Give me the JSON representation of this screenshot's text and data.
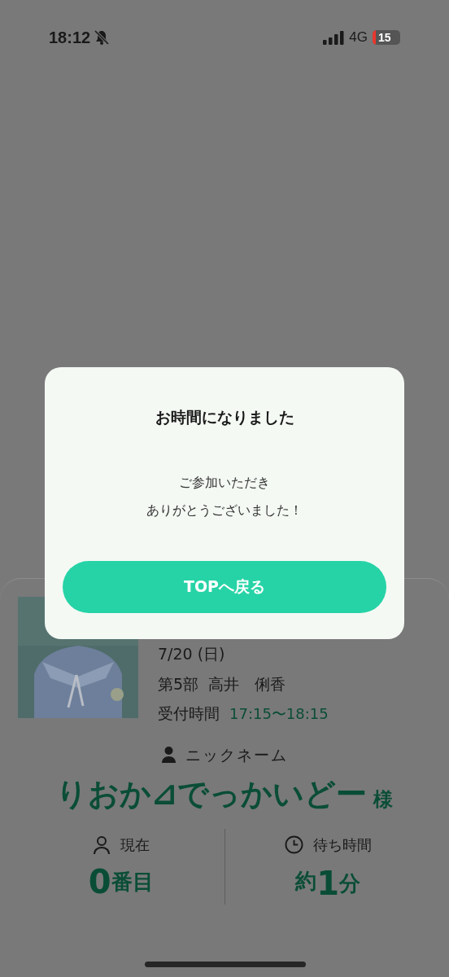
{
  "status_bar": {
    "time": "18:12",
    "silent": true,
    "network": "4G",
    "battery": "15"
  },
  "event_card": {
    "date": "7/20 (日)",
    "session": "第5部  高井　俐香",
    "reception_label": "受付時間",
    "reception_time": "17:15〜18:15"
  },
  "nickname": {
    "label": "ニックネーム",
    "name": "りおか⊿でっかいどー",
    "suffix": "様"
  },
  "stats": [
    {
      "kind": "person",
      "label": "現在",
      "number": "0",
      "unit_after": "番目"
    },
    {
      "kind": "clock",
      "label": "待ち時間",
      "number": "1",
      "unit_before": "約",
      "unit_after": "分"
    }
  ],
  "dialog": {
    "title": "お時間になりました",
    "message_lines": [
      "ご参加いただき",
      "ありがとうございました！"
    ],
    "button": "TOPへ戻る"
  }
}
